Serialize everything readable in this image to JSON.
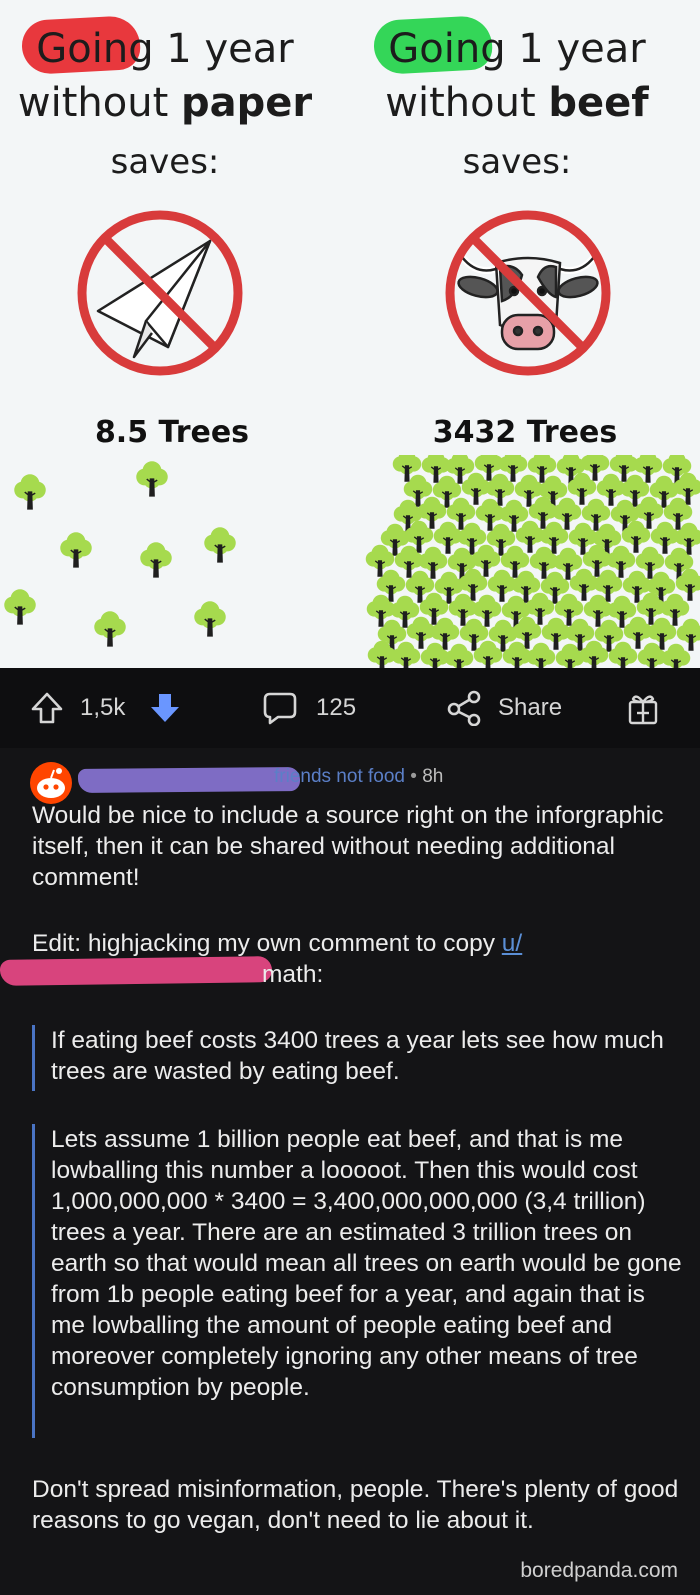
{
  "infographic": {
    "left": {
      "highlight_word": "Going",
      "headline_rest": " 1 year",
      "line2_prefix": "without ",
      "line2_bold": "paper",
      "saves": "saves:",
      "icon": "paper-plane-icon",
      "trees_label": "8.5 Trees",
      "highlight_color": "#e8383d"
    },
    "right": {
      "highlight_word": "Going",
      "headline_rest": " 1 year",
      "line2_prefix": "without ",
      "line2_bold": "beef",
      "saves": "saves:",
      "icon": "cow-icon",
      "trees_label": "3432 Trees",
      "highlight_color": "#34d658"
    },
    "tree_color": "#a6da4e",
    "prohibition_color": "#d83b3b"
  },
  "actions": {
    "upvotes": "1,5k",
    "comments": "125",
    "share_label": "Share",
    "downvote_color": "#6a96ff"
  },
  "comment": {
    "flair": "friends not food",
    "time": "8h",
    "paragraph1": "Would be nice to include a source right on the inforgraphic itself, then it can be shared without needing additional comment!",
    "edit_prefix": "Edit: highjacking my own comment to copy ",
    "edit_link": "u/",
    "edit_suffix": "math:",
    "quote1": "If eating beef costs 3400 trees a year lets see how much trees are wasted by eating beef.",
    "quote2": "Lets assume 1 billion people eat beef, and that is me lowballing this number a looooot. Then this would cost 1,000,000,000 * 3400 = 3,400,000,000,000 (3,4 trillion) trees a year. There are an estimated 3 trillion trees on earth so that would mean all trees on earth would be gone from 1b people eating beef for a year, and again that is me lowballing the amount of people eating beef and moreover completely ignoring any other means of tree consumption by people.",
    "final": "Don't spread misinformation, people. There's plenty of good reasons to go vegan, don't need to lie about it."
  },
  "watermark": "boredpanda.com"
}
